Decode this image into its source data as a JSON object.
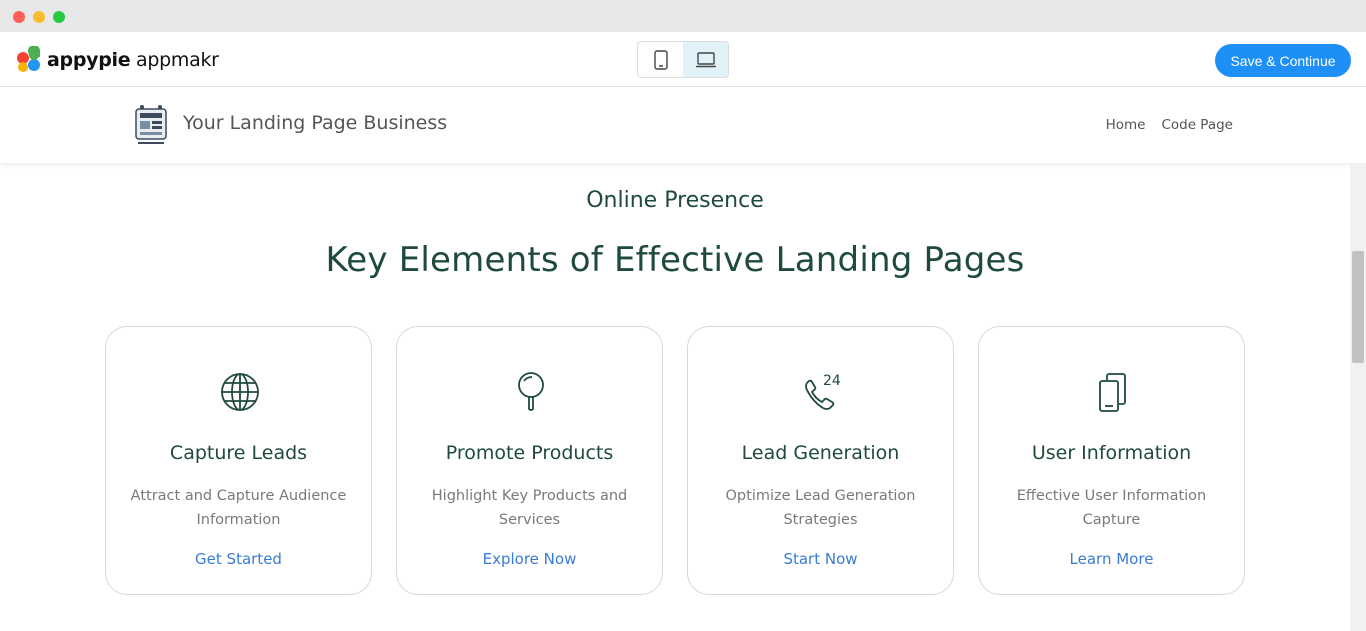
{
  "builder": {
    "brand_name_bold": "appypie",
    "brand_name_light": " appmakr",
    "save_label": "Save & Continue",
    "devices": [
      "mobile",
      "desktop"
    ],
    "active_device": "desktop",
    "accent_color": "#1e8ff6"
  },
  "site": {
    "title": "Your Landing Page Business",
    "nav": [
      "Home",
      "Code Page"
    ]
  },
  "section": {
    "kicker": "Online Presence",
    "title": "Key Elements of Effective Landing Pages",
    "text_color": "#1f4a3e",
    "link_color": "#3a7bd5"
  },
  "cards": [
    {
      "icon": "globe-icon",
      "title": "Capture Leads",
      "description": "Attract and Capture Audience Information",
      "link": "Get Started"
    },
    {
      "icon": "magnifier-icon",
      "title": "Promote Products",
      "description": "Highlight Key Products and Services",
      "link": "Explore Now"
    },
    {
      "icon": "phone-24-icon",
      "title": "Lead Generation",
      "description": "Optimize Lead Generation Strategies",
      "link": "Start Now"
    },
    {
      "icon": "devices-icon",
      "title": "User Information",
      "description": "Effective User Information Capture",
      "link": "Learn More"
    }
  ]
}
